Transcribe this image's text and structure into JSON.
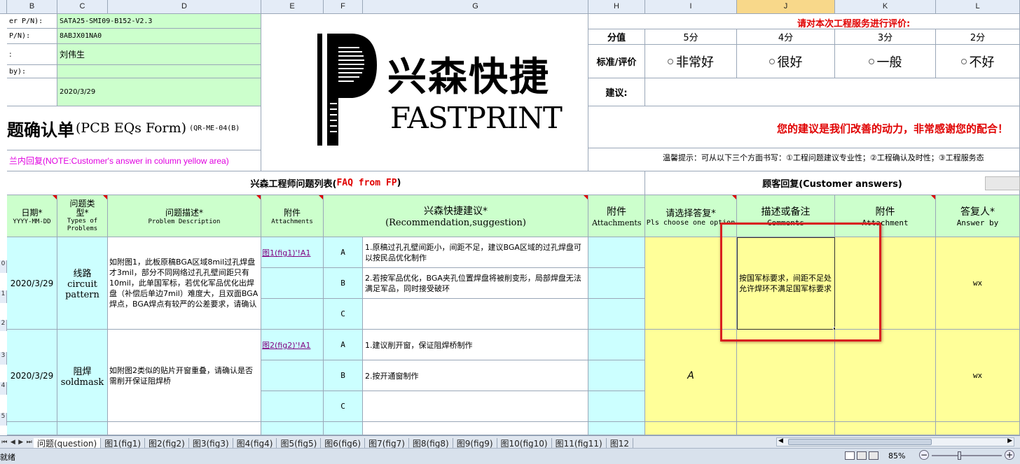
{
  "columns": [
    "B",
    "C",
    "D",
    "E",
    "F",
    "G",
    "H",
    "I",
    "J",
    "K",
    "L"
  ],
  "row_numbers": [
    "0",
    "1",
    "2",
    "3",
    "4",
    "5"
  ],
  "header_info": {
    "r1_label": "er P/N):",
    "r1_value": "SATA25-SMI09-B152-V2.3",
    "r2_label": "P/N):",
    "r2_value": "8ABJX01NA0",
    "r3_label": ":",
    "r3_value": "刘伟生",
    "r4_label": "by):",
    "r4_value": "",
    "r5_value": "2020/3/29"
  },
  "form_title": "题确认单",
  "form_title_en": "(PCB EQs Form)",
  "form_code": "(QR-ME-04(B)",
  "note_text": "兰内回复(NOTE:Customer's answer in column yellow area)",
  "logo": {
    "cn": "兴森快捷",
    "en": "FASTPRINT"
  },
  "rating": {
    "title": "请对本次工程服务进行评价:",
    "score_label": "分值",
    "scores": [
      "5分",
      "4分",
      "3分",
      "2分"
    ],
    "std_label": "标准/评价",
    "options": [
      "非常好",
      "很好",
      "一般",
      "不好"
    ],
    "suggest_label": "建议:",
    "thanks": "您的建议是我们改善的动力，非常感谢您的配合！",
    "tip": "温馨提示：可从以下三个方面书写：①工程问题建议专业性；②工程确认及时性；③工程服务态"
  },
  "faq_title_cn": "兴森工程师问题列表(",
  "faq_title_en": "FAQ from FP",
  "faq_title_end": ")",
  "cust_title": "顾客回复(Customer answers)",
  "table_headers": {
    "date": "日期*",
    "date_fmt": "YYYY-MM-DD",
    "type": "问题类型*",
    "type_en": "Types of Problems",
    "desc": "问题描述*",
    "desc_en": "Problem Description",
    "att": "附件",
    "att_en": "Attachments",
    "rec": "兴森快捷建议*",
    "rec_en": "(Recommendation,suggestion)",
    "att2": "附件",
    "att2_en": "Attachments",
    "choose": "请选择答复*",
    "choose_en": "Pls choose one option",
    "comments": "描述或备注",
    "comments_en": "Comments",
    "att3": "附件",
    "att3_en": "Attachment",
    "answer_by": "答复人*",
    "answer_by_en": "Answer by"
  },
  "rows": [
    {
      "date": "2020/3/29",
      "type_cn": "线路",
      "type_en1": "circuit",
      "type_en2": "pattern",
      "desc": "如附图1，此板原稿BGA区域8mil过孔焊盘才3mil，部分不同网络过孔孔壁间距只有10mil，此单国军标，若优化军品优化出焊盘（补偿后单边7mil）难度大，且双面BGA焊点，BGA焊点有较严的公差要求，请确认",
      "link": "图1(fig1)'!A1",
      "options": [
        {
          "letter": "A",
          "text": "1.原稿过孔孔壁间距小，间距不足，建议BGA区域的过孔焊盘可以按民品优化制作"
        },
        {
          "letter": "B",
          "text": "2.若按军品优化，BGA夹孔位置焊盘将被削变形，局部焊盘无法满足军品，同时接受破环"
        },
        {
          "letter": "C",
          "text": ""
        }
      ],
      "choice": "",
      "comment": "按国军标要求，间距不足处允许焊环不满足国军标要求",
      "answer_by": "wx"
    },
    {
      "date": "2020/3/29",
      "type_cn": "阻焊",
      "type_en1": "soldmask",
      "type_en2": "",
      "desc": "如附图2类似的贴片开窗重叠，请确认是否需削开保证阻焊桥",
      "link": "图2(fig2)'!A1",
      "options": [
        {
          "letter": "A",
          "text": "1.建议削开窗，保证阻焊桥制作"
        },
        {
          "letter": "B",
          "text": "2.按开通窗制作"
        },
        {
          "letter": "C",
          "text": ""
        }
      ],
      "choice": "A",
      "comment": "",
      "answer_by": "wx"
    }
  ],
  "tabs": [
    "问题(question)",
    "图1(fig1)",
    "图2(fig2)",
    "图3(fig3)",
    "图4(fig4)",
    "图5(fig5)",
    "图6(fig6)",
    "图7(fig7)",
    "图8(fig8)",
    "图9(fig9)",
    "图10(fig10)",
    "图11(fig11)",
    "图12"
  ],
  "status": {
    "ready": "就绪",
    "zoom": "85%"
  },
  "colors": {
    "highlight": "#d92020",
    "rating_red": "#e00000",
    "note_magenta": "#e000e0"
  }
}
